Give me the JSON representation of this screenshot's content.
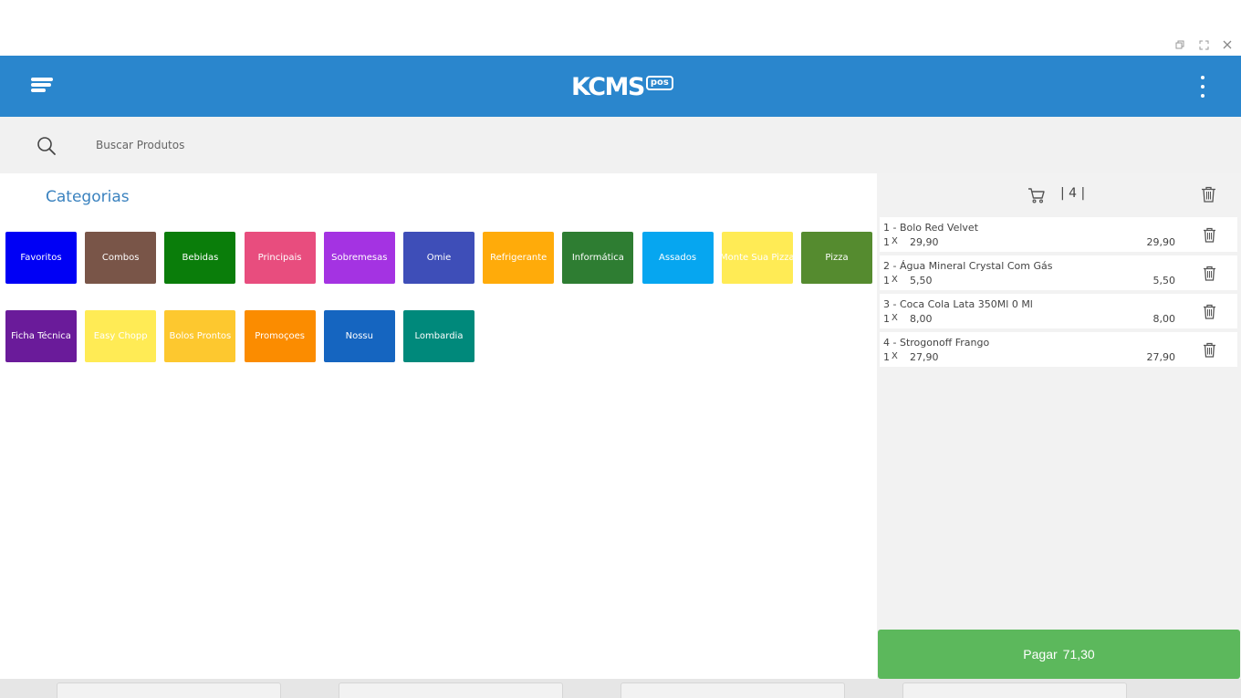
{
  "window": {
    "controls": [
      "restore",
      "maximize",
      "close"
    ]
  },
  "header": {
    "logo_main": "KCMS",
    "logo_sub": "pos",
    "colors": {
      "bar": "#2a86cd"
    }
  },
  "search": {
    "placeholder": "Buscar Produtos"
  },
  "categories": {
    "title": "Categorias",
    "items": [
      {
        "label": "Favoritos",
        "color": "#0000f5"
      },
      {
        "label": "Combos",
        "color": "#795548"
      },
      {
        "label": "Bebidas",
        "color": "#0a7d0a"
      },
      {
        "label": "Principais",
        "color": "#e84d7e"
      },
      {
        "label": "Sobremesas",
        "color": "#a433e2"
      },
      {
        "label": "Omie",
        "color": "#3e4eb8"
      },
      {
        "label": "Refrigerante",
        "color": "#ffab0a"
      },
      {
        "label": "Informática",
        "color": "#2e7d32"
      },
      {
        "label": "Assados",
        "color": "#06a6f0"
      },
      {
        "label": "Monte Sua Pizza",
        "color": "#ffeb55"
      },
      {
        "label": "Pizza",
        "color": "#558b2f"
      },
      {
        "label": "Ficha Técnica",
        "color": "#6a1b9a"
      },
      {
        "label": "Easy Chopp",
        "color": "#ffeb55"
      },
      {
        "label": "Bolos Prontos",
        "color": "#fdc82f"
      },
      {
        "label": "Promoçoes",
        "color": "#fb8c00"
      },
      {
        "label": "Nossu",
        "color": "#1565c0"
      },
      {
        "label": "Lombardia",
        "color": "#00897b"
      }
    ]
  },
  "cart": {
    "count_label": "| 4 |",
    "items": [
      {
        "name": "1 - Bolo Red Velvet",
        "qty": "1",
        "x": "X",
        "unit": "29,90",
        "total": "29,90"
      },
      {
        "name": "2 - Água Mineral Crystal Com Gás",
        "qty": "1",
        "x": "X",
        "unit": "5,50",
        "total": "5,50"
      },
      {
        "name": "3 - Coca Cola Lata 350Ml 0 Ml",
        "qty": "1",
        "x": "X",
        "unit": "8,00",
        "total": "8,00"
      },
      {
        "name": "4 - Strogonoff Frango",
        "qty": "1",
        "x": "X",
        "unit": "27,90",
        "total": "27,90"
      }
    ]
  },
  "pay": {
    "label": "Pagar",
    "amount": "71,30",
    "color": "#5cb85c"
  }
}
